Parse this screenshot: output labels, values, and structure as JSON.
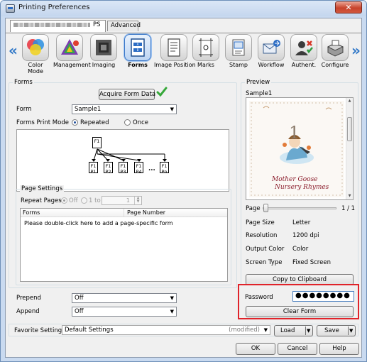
{
  "window": {
    "title": "Printing Preferences",
    "close_glyph": "✕"
  },
  "tabs": {
    "printer_suffix": "PS",
    "advanced": "Advanced"
  },
  "nav": {
    "left": "«",
    "right": "»"
  },
  "categories": [
    {
      "label": "Color\nMode",
      "icon": "color-wheel-icon"
    },
    {
      "label": "Management",
      "icon": "palette-icon"
    },
    {
      "label": "Imaging",
      "icon": "imaging-icon"
    },
    {
      "label": "Forms",
      "icon": "forms-icon"
    },
    {
      "label": "Image Position",
      "icon": "document-icon"
    },
    {
      "label": "Marks",
      "icon": "marks-icon"
    },
    {
      "label": "Stamp",
      "icon": "stamp-icon"
    },
    {
      "label": "Workflow",
      "icon": "workflow-icon"
    },
    {
      "label": "Authent.",
      "icon": "authentication-icon"
    },
    {
      "label": "Configure",
      "icon": "printer-icon"
    }
  ],
  "forms": {
    "group_label": "Forms",
    "acquire_button": "Acquire Form Data",
    "form_label": "Form",
    "form_value": "Sample1",
    "print_mode_label": "Forms Print Mode",
    "mode_repeated": "Repeated",
    "mode_once": "Once",
    "diagram_top": "F1",
    "diagram_pages": [
      "F1\nP1",
      "F1\nP2",
      "F1\nP3",
      "F1\nP4",
      "F1\nPn"
    ],
    "ellipsis": "..."
  },
  "page_settings": {
    "group_label": "Page Settings",
    "repeat_label": "Repeat Pages",
    "off": "Off",
    "one_to": "1 to",
    "spin_value": "1",
    "col_forms": "Forms",
    "col_page": "Page Number",
    "row_hint": "Please double-click here to add a page-specific form"
  },
  "prepend": {
    "label": "Prepend",
    "value": "Off"
  },
  "append": {
    "label": "Append",
    "value": "Off"
  },
  "preview": {
    "group_label": "Preview",
    "sample": "Sample1",
    "page_label": "Page",
    "page_count": "1 / 1",
    "card_number": "1",
    "card_title_1": "Mother Goose",
    "card_title_2": "Nursery Rhymes",
    "page_size_label": "Page Size",
    "page_size": "Letter",
    "resolution_label": "Resolution",
    "resolution": "1200 dpi",
    "output_color_label": "Output Color",
    "output_color": "Color",
    "screen_type_label": "Screen Type",
    "screen_type": "Fixed Screen",
    "copy_button": "Copy to Clipboard"
  },
  "security": {
    "password_label": "Password",
    "password_value": "●●●●●●●●",
    "clear_button": "Clear Form",
    "highlight_color": "#e0232a"
  },
  "favorite": {
    "label": "Favorite Setting",
    "value": "Default Settings",
    "modified": "(modified)",
    "load": "Load",
    "save": "Save"
  },
  "footer": {
    "ok": "OK",
    "cancel": "Cancel",
    "help": "Help"
  }
}
